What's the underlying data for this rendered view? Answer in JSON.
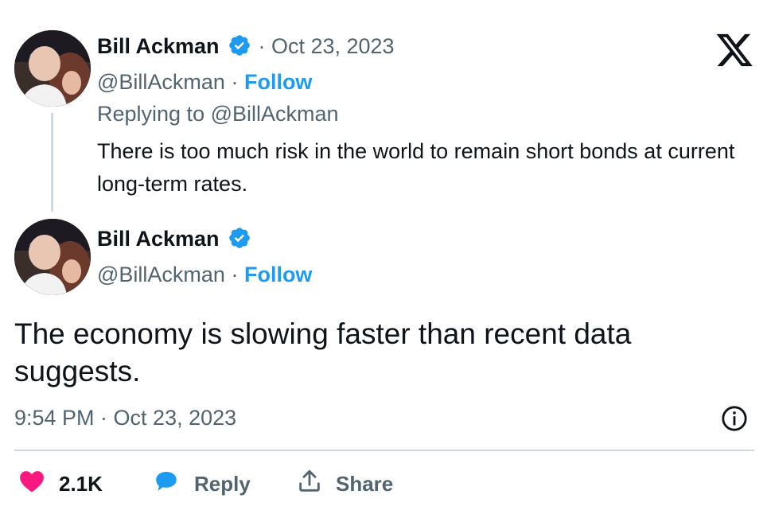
{
  "reply_tweet": {
    "author_name": "Bill Ackman",
    "date": "· Oct 23, 2023",
    "handle": "@BillAckman",
    "separator": " · ",
    "follow_label": "Follow",
    "replying_to": "Replying to @BillAckman",
    "text": "There is too much risk in the world to remain short bonds at current long-term rates."
  },
  "main_tweet": {
    "author_name": "Bill Ackman",
    "handle": "@BillAckman",
    "separator": " · ",
    "follow_label": "Follow",
    "text": "The economy is slowing faster than recent data suggests.",
    "timestamp": "9:54 PM · Oct 23, 2023"
  },
  "actions": {
    "like_count": "2.1K",
    "reply_label": "Reply",
    "share_label": "Share"
  },
  "colors": {
    "accent": "#1d9bf0",
    "like": "#f91880",
    "text": "#0f1419",
    "muted": "#536471",
    "divider": "#cfd9de"
  },
  "icons": [
    "x-logo-icon",
    "verified-badge-icon",
    "info-icon",
    "heart-icon",
    "reply-bubble-icon",
    "share-icon"
  ]
}
